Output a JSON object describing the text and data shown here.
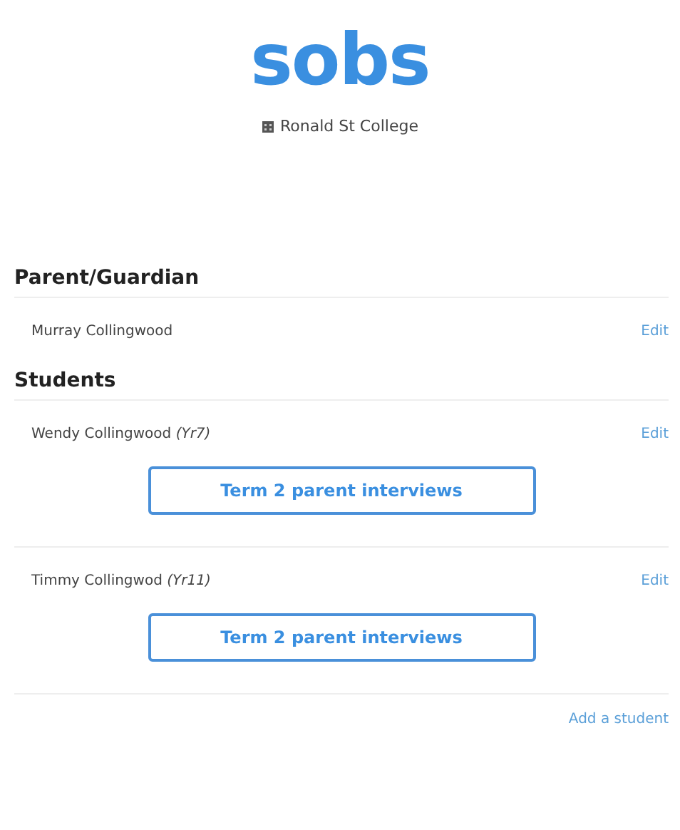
{
  "logo": "sobs",
  "school": "Ronald St College",
  "parent_section": {
    "heading": "Parent/Guardian",
    "rows": [
      {
        "name": "Murray Collingwood",
        "action": "Edit"
      }
    ]
  },
  "students_section": {
    "heading": "Students",
    "students": [
      {
        "name": "Wendy Collingwood *(Yr7)*",
        "action": "Edit",
        "button": "Term 2 parent interviews"
      },
      {
        "name": "Timmy Collingwod *(Yr11)*",
        "action": "Edit",
        "button": "Term 2 parent interviews"
      }
    ],
    "add_link": "Add a student"
  }
}
